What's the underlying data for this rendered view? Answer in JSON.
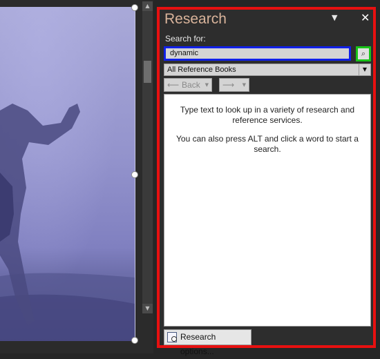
{
  "pane": {
    "title": "Research",
    "menu_glyph": "▼",
    "close_glyph": "✕",
    "search_label": "Search for:",
    "search_value": "dynamic",
    "search_go_glyph": "⌕",
    "source_value": "All Reference Books",
    "source_dropdown_glyph": "▼",
    "back_label": "Back",
    "back_arrow": "⟵",
    "forward_arrow": "⟶",
    "dropdown_glyph": "▼",
    "message_1": "Type text to look up in a variety of research and reference services.",
    "message_2": "You can also press ALT and click a word to start a search.",
    "options_label": "Research options..."
  },
  "scrollbar": {
    "up_glyph": "▲",
    "down_glyph": "▼"
  },
  "colors": {
    "highlight_pane": "#e81010",
    "highlight_search": "#1020e8",
    "highlight_go": "#18c418",
    "title_text": "#d9b49b"
  }
}
